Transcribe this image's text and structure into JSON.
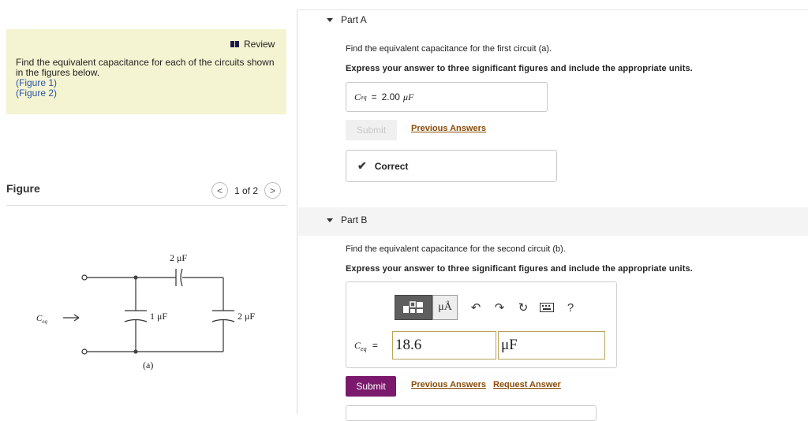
{
  "left": {
    "review_label": "Review",
    "intro_line1": "Find the equivalent capacitance for each of the circuits shown",
    "intro_line2": "in the figures below.",
    "figure_links": [
      "(Figure 1)",
      "(Figure 2)"
    ],
    "figure_title": "Figure",
    "pager": {
      "text": "1 of 2",
      "prev": "<",
      "next": ">"
    },
    "circuit": {
      "top_cap": "2 μF",
      "left_cap": "1 μF",
      "right_cap": "2 μF",
      "ceq": "C",
      "ceq_sub": "eq",
      "caption": "(a)"
    }
  },
  "partA": {
    "title": "Part A",
    "question": "Find the equivalent capacitance for the first circuit (a).",
    "instruction": "Express your answer to three significant figures and include the appropriate units.",
    "answer_symbol": "C",
    "answer_sub": "eq",
    "answer_equals": "=",
    "answer_value": "2.00",
    "answer_unit": "μF",
    "submit": "Submit",
    "previous_answers": "Previous Answers",
    "feedback": "Correct"
  },
  "partB": {
    "title": "Part B",
    "question": "Find the equivalent capacitance for the second circuit (b).",
    "instruction": "Express your answer to three significant figures and include the appropriate units.",
    "toolbar": {
      "units_label": "μÅ",
      "help": "?"
    },
    "answer_symbol": "C",
    "answer_sub": "eq",
    "answer_equals": "=",
    "input_value": "18.6",
    "unit_value": "μF",
    "submit": "Submit",
    "previous_answers": "Previous Answers",
    "request_answer": "Request Answer"
  },
  "colors": {
    "review_bg": "#f4f4d2",
    "submit_active": "#7b1a6c",
    "link": "#8a4b06",
    "figure_link": "#2a56a8"
  }
}
